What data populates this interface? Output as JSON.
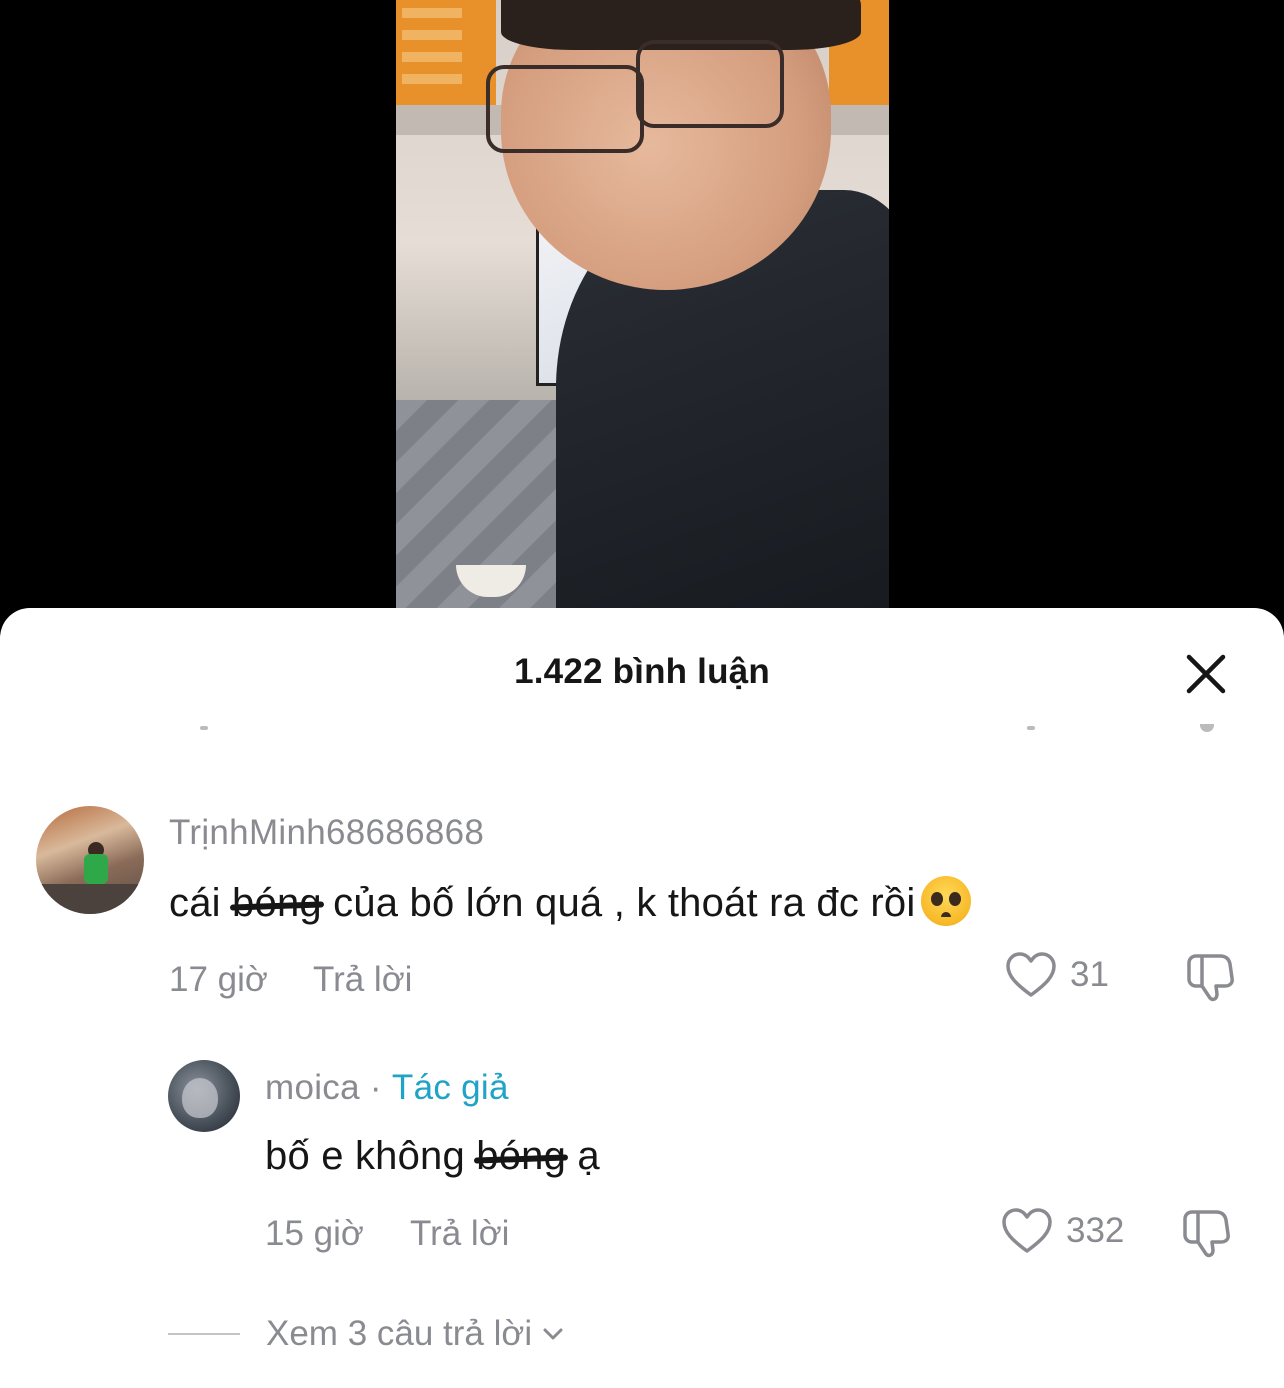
{
  "sheet": {
    "title": "1.422 bình luận"
  },
  "comments": [
    {
      "username": "TrịnhMinh68686868",
      "text_before": "cái ",
      "text_scribbled": "bóng",
      "text_after": " của bố lớn quá , k thoát ra đc rồi",
      "emoji": "pleading-face-emoji",
      "time": "17 giờ",
      "reply_label": "Trả lời",
      "likes": "31"
    }
  ],
  "replies": [
    {
      "username": "moica",
      "separator": " · ",
      "author_tag": "Tác giả",
      "text_before": "bố e không ",
      "text_scribbled": "bóng",
      "text_after": " ạ",
      "time": "15 giờ",
      "reply_label": "Trả lời",
      "likes": "332"
    }
  ],
  "view_replies": {
    "label": "Xem 3 câu trả lời"
  },
  "colors": {
    "sheet_bg": "#ffffff",
    "text_primary": "#161616",
    "text_secondary": "#8a8b91",
    "author_tag": "#1fa3c7"
  },
  "icons": {
    "close": "close-icon",
    "like": "heart-outline-icon",
    "dislike": "thumbs-down-icon",
    "expand": "chevron-down-icon"
  }
}
